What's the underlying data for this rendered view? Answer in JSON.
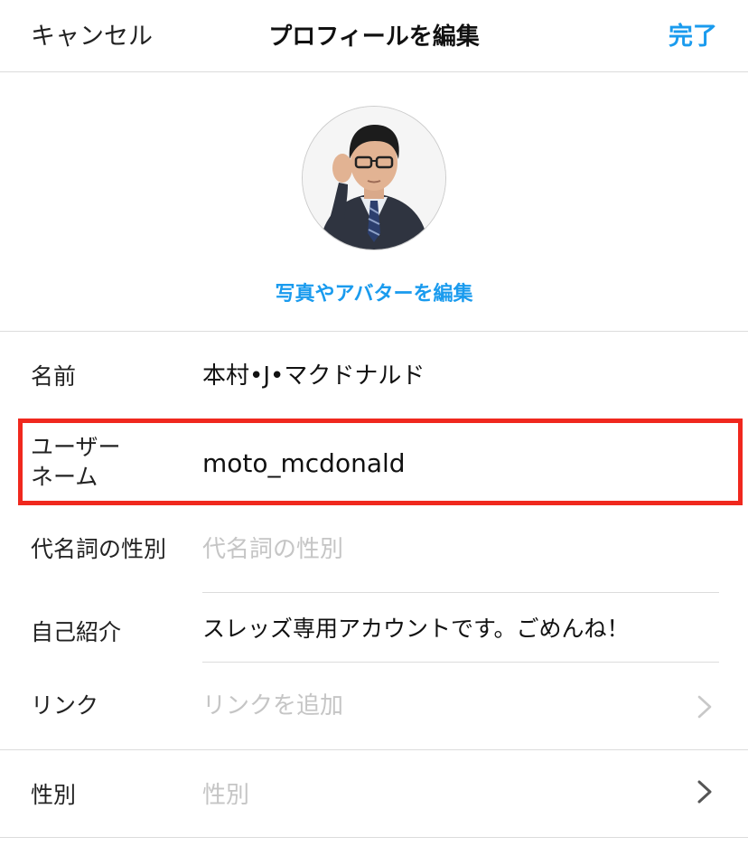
{
  "header": {
    "cancel_label": "キャンセル",
    "title": "プロフィールを編集",
    "done_label": "完了"
  },
  "avatar": {
    "edit_label": "写真やアバターを編集"
  },
  "fields": {
    "name": {
      "label": "名前",
      "value": "本村•J•マクドナルド"
    },
    "username": {
      "label_line1": "ユーザー",
      "label_line2": "ネーム",
      "value": "moto_mcdonald"
    },
    "pronouns": {
      "label": "代名詞の性別",
      "placeholder": "代名詞の性別"
    },
    "bio": {
      "label": "自己紹介",
      "value": "スレッズ専用アカウントです。ごめんね！"
    },
    "link": {
      "label": "リンク",
      "placeholder": "リンクを追加"
    },
    "gender": {
      "label": "性別",
      "placeholder": "性別"
    }
  },
  "colors": {
    "accent": "#1a9bee",
    "highlight": "#f0281e",
    "divider": "#dcdcdc",
    "placeholder": "#c5c5c5"
  },
  "icons": {
    "link_chevron": "chevron-right-icon",
    "gender_chevron": "chevron-right-icon"
  }
}
